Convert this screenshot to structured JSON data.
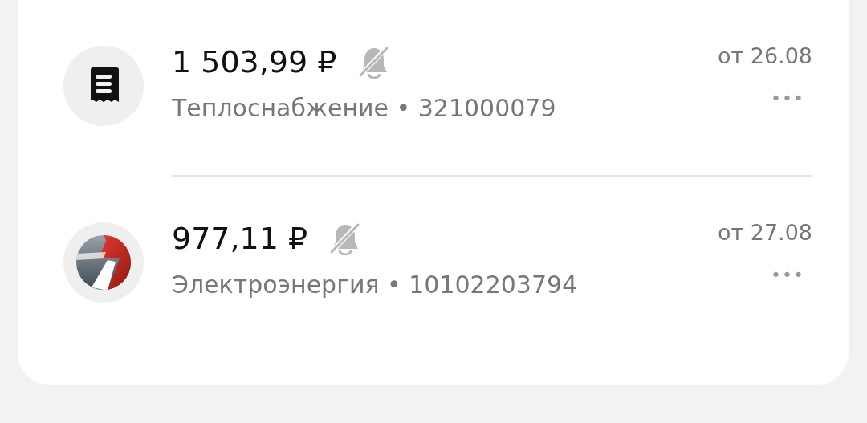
{
  "bills": [
    {
      "kind": "receipt",
      "amount": "1 503,99 ₽",
      "notifications_muted": true,
      "subtitle": "Теплоснабжение • 321000079",
      "date": "от 26.08",
      "menu": "•••"
    },
    {
      "kind": "logo",
      "amount": "977,11 ₽",
      "notifications_muted": true,
      "subtitle": "Электроэнергия • 10102203794",
      "date": "от 27.08",
      "menu": "•••"
    }
  ]
}
